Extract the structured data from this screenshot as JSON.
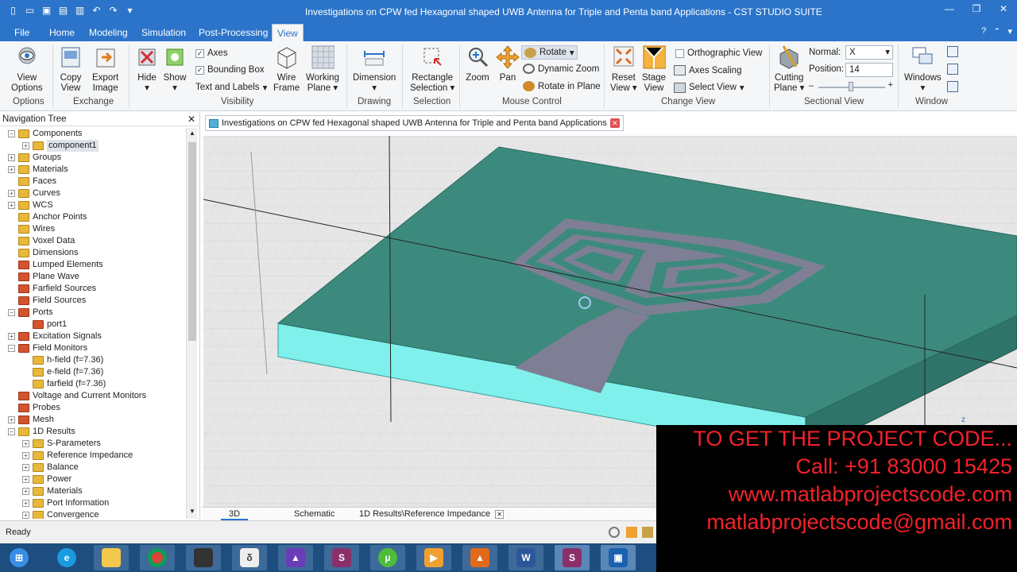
{
  "window": {
    "title": "Investigations on CPW fed Hexagonal shaped UWB Antenna for Triple and Penta band Applications - CST STUDIO SUITE"
  },
  "menu": {
    "file": "File",
    "tabs": [
      "Home",
      "Modeling",
      "Simulation",
      "Post-Processing",
      "View"
    ],
    "active_tab": "View"
  },
  "ribbon": {
    "view_options": [
      "View",
      "Options"
    ],
    "copy_view": [
      "Copy",
      "View"
    ],
    "export_image": [
      "Export",
      "Image"
    ],
    "hide": "Hide",
    "show": "Show",
    "axes": "Axes",
    "bounding_box": "Bounding Box",
    "text_and_labels": "Text and Labels",
    "wire_frame": [
      "Wire",
      "Frame"
    ],
    "working_plane": [
      "Working",
      "Plane"
    ],
    "dimension": "Dimension",
    "rectangle_selection": [
      "Rectangle",
      "Selection"
    ],
    "zoom": "Zoom",
    "pan": "Pan",
    "rotate": "Rotate",
    "dynamic_zoom": "Dynamic Zoom",
    "rotate_in_plane": "Rotate in Plane",
    "reset_view": [
      "Reset",
      "View"
    ],
    "stage_view": [
      "Stage",
      "View"
    ],
    "orthographic_view": "Orthographic View",
    "axes_scaling": "Axes Scaling",
    "select_view": "Select View",
    "cutting_plane": [
      "Cutting",
      "Plane"
    ],
    "normal_label": "Normal:",
    "normal_value": "X",
    "position_label": "Position:",
    "position_value": "14",
    "windows": "Windows",
    "groups": [
      "Options",
      "Exchange",
      "Visibility",
      "Drawing",
      "Selection",
      "Mouse Control",
      "Change View",
      "Sectional View",
      "Window"
    ]
  },
  "nav": {
    "title": "Navigation Tree",
    "items": [
      {
        "label": "Components",
        "level": 0,
        "exp": "-",
        "red": false
      },
      {
        "label": "component1",
        "level": 1,
        "exp": "+",
        "red": false,
        "selected": true
      },
      {
        "label": "Groups",
        "level": 0,
        "exp": "+",
        "red": false
      },
      {
        "label": "Materials",
        "level": 0,
        "exp": "+",
        "red": false
      },
      {
        "label": "Faces",
        "level": 0,
        "exp": "",
        "red": false
      },
      {
        "label": "Curves",
        "level": 0,
        "exp": "+",
        "red": false
      },
      {
        "label": "WCS",
        "level": 0,
        "exp": "+",
        "red": false
      },
      {
        "label": "Anchor Points",
        "level": 0,
        "exp": "",
        "red": false
      },
      {
        "label": "Wires",
        "level": 0,
        "exp": "",
        "red": false
      },
      {
        "label": "Voxel Data",
        "level": 0,
        "exp": "",
        "red": false
      },
      {
        "label": "Dimensions",
        "level": 0,
        "exp": "",
        "red": false
      },
      {
        "label": "Lumped Elements",
        "level": 0,
        "exp": "",
        "red": true
      },
      {
        "label": "Plane Wave",
        "level": 0,
        "exp": "",
        "red": true
      },
      {
        "label": "Farfield Sources",
        "level": 0,
        "exp": "",
        "red": true
      },
      {
        "label": "Field Sources",
        "level": 0,
        "exp": "",
        "red": true
      },
      {
        "label": "Ports",
        "level": 0,
        "exp": "-",
        "red": true
      },
      {
        "label": "port1",
        "level": 1,
        "exp": "",
        "red": true
      },
      {
        "label": "Excitation Signals",
        "level": 0,
        "exp": "+",
        "red": true
      },
      {
        "label": "Field Monitors",
        "level": 0,
        "exp": "-",
        "red": true
      },
      {
        "label": "h-field (f=7.36)",
        "level": 1,
        "exp": "",
        "red": false
      },
      {
        "label": "e-field (f=7.36)",
        "level": 1,
        "exp": "",
        "red": false
      },
      {
        "label": "farfield (f=7.36)",
        "level": 1,
        "exp": "",
        "red": false
      },
      {
        "label": "Voltage and Current Monitors",
        "level": 0,
        "exp": "",
        "red": true
      },
      {
        "label": "Probes",
        "level": 0,
        "exp": "",
        "red": true
      },
      {
        "label": "Mesh",
        "level": 0,
        "exp": "+",
        "red": true
      },
      {
        "label": "1D Results",
        "level": 0,
        "exp": "-",
        "red": false
      },
      {
        "label": "S-Parameters",
        "level": 1,
        "exp": "+",
        "red": false
      },
      {
        "label": "Reference Impedance",
        "level": 1,
        "exp": "+",
        "red": false
      },
      {
        "label": "Balance",
        "level": 1,
        "exp": "+",
        "red": false
      },
      {
        "label": "Power",
        "level": 1,
        "exp": "+",
        "red": false
      },
      {
        "label": "Materials",
        "level": 1,
        "exp": "+",
        "red": false
      },
      {
        "label": "Port Information",
        "level": 1,
        "exp": "+",
        "red": false
      },
      {
        "label": "Convergence",
        "level": 1,
        "exp": "+",
        "red": false
      }
    ]
  },
  "document": {
    "tab_title": "Investigations on CPW fed Hexagonal shaped UWB Antenna for Triple and Penta band Applications",
    "axis_label": "z",
    "bottom_tabs": [
      "3D",
      "Schematic",
      "1D Results\\Reference Impedance"
    ]
  },
  "status": {
    "text": "Ready"
  },
  "taskbar": {
    "apps": [
      "start-icon",
      "ie-icon",
      "explorer-icon",
      "chrome-icon",
      "chip-icon",
      "file-icon",
      "app-icon",
      "cst-icon",
      "torrent-icon",
      "media-icon",
      "matlab-icon",
      "word-icon",
      "cst-active-icon",
      "paint-icon"
    ]
  },
  "promo": {
    "line1": "TO GET THE PROJECT CODE...",
    "line2": "Call: +91 83000 15425",
    "line3": "www.matlabprojectscode.com",
    "line4": "matlabprojectscode@gmail.com"
  },
  "colors": {
    "accent": "#2b74c9",
    "substrate_top": "#3c8a7d",
    "substrate_side": "#7ff0ec",
    "metal": "#7e7f94",
    "promo_text": "#f4212b"
  }
}
